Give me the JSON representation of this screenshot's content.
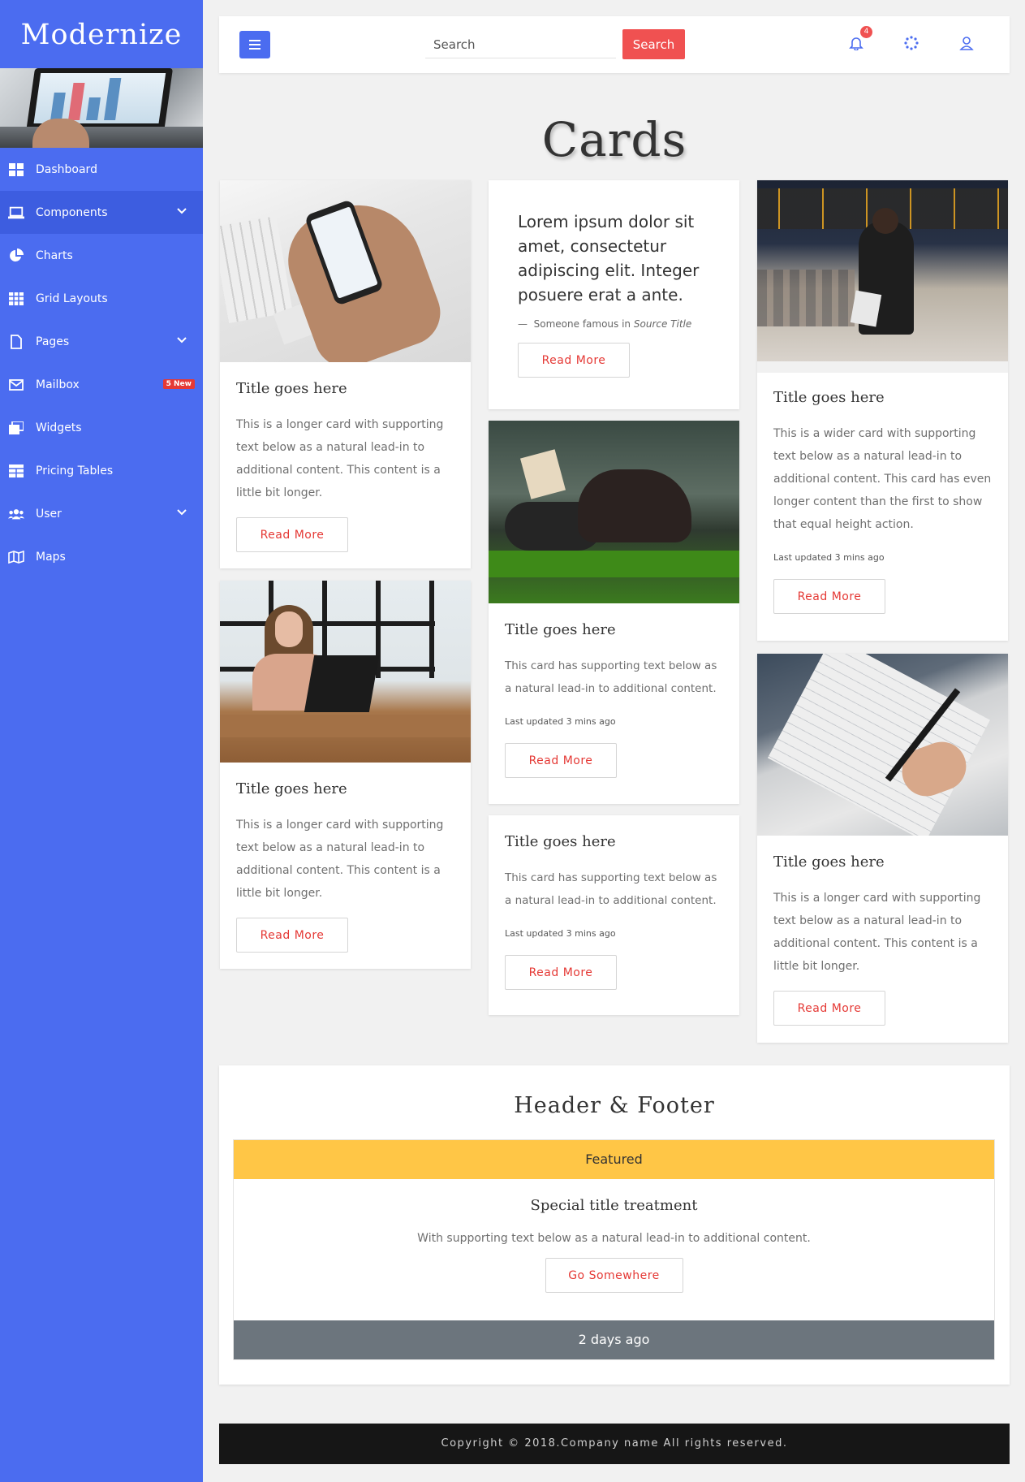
{
  "brand": "Modernize",
  "sidebar": {
    "items": [
      {
        "label": "Dashboard",
        "icon": "grid-icon"
      },
      {
        "label": "Components",
        "icon": "laptop-icon",
        "has_chevron": true,
        "active": true
      },
      {
        "label": "Charts",
        "icon": "pie-chart-icon"
      },
      {
        "label": "Grid Layouts",
        "icon": "table-icon"
      },
      {
        "label": "Pages",
        "icon": "file-icon",
        "has_chevron": true
      },
      {
        "label": "Mailbox",
        "icon": "envelope-icon",
        "badge": "5 New"
      },
      {
        "label": "Widgets",
        "icon": "windows-icon"
      },
      {
        "label": "Pricing Tables",
        "icon": "pricing-table-icon"
      },
      {
        "label": "User",
        "icon": "users-icon",
        "has_chevron": true
      },
      {
        "label": "Maps",
        "icon": "map-icon"
      }
    ]
  },
  "topbar": {
    "search_placeholder": "Search",
    "search_button": "Search",
    "notification_count": "4"
  },
  "page_title": "Cards",
  "cards": {
    "c1": {
      "title": "Title goes here",
      "text": "This is a longer card with supporting text below as a natural lead-in to additional content. This content is a little bit longer.",
      "button": "Read More"
    },
    "c2": {
      "quote": "Lorem ipsum dolor sit amet, consectetur adipiscing elit. Integer posuere erat a ante.",
      "source_prefix": "Someone famous in",
      "source_title": "Source Title",
      "button": "Read More"
    },
    "c3": {
      "title": "Title goes here",
      "text": "This is a wider card with supporting text below as a natural lead-in to additional content. This card has even longer content than the first to show that equal height action.",
      "meta": "Last updated 3 mins ago",
      "button": "Read More"
    },
    "c4": {
      "title": "Title goes here",
      "text": "This card has supporting text below as a natural lead-in to additional content.",
      "meta": "Last updated 3 mins ago",
      "button": "Read More"
    },
    "c5": {
      "title": "Title goes here",
      "text": "This is a longer card with supporting text below as a natural lead-in to additional content. This content is a little bit longer.",
      "button": "Read More"
    },
    "c6": {
      "title": "Title goes here",
      "text": "This card has supporting text below as a natural lead-in to additional content.",
      "meta": "Last updated 3 mins ago",
      "button": "Read More"
    },
    "c7": {
      "title": "Title goes here",
      "text": "This is a longer card with supporting text below as a natural lead-in to additional content. This content is a little bit longer.",
      "button": "Read More"
    }
  },
  "header_footer": {
    "title": "Header & Footer",
    "header": "Featured",
    "special_title": "Special title treatment",
    "text": "With supporting text below as a natural lead-in to additional content.",
    "button": "Go Somewhere",
    "footer": "2 days ago"
  },
  "footer": "Copyright © 2018.Company name All rights reserved.",
  "colors": {
    "sidebar": "#4b6cf0",
    "accent_red": "#f05151",
    "featured_yellow": "#ffc646",
    "card_footer_gray": "#6c757d"
  }
}
